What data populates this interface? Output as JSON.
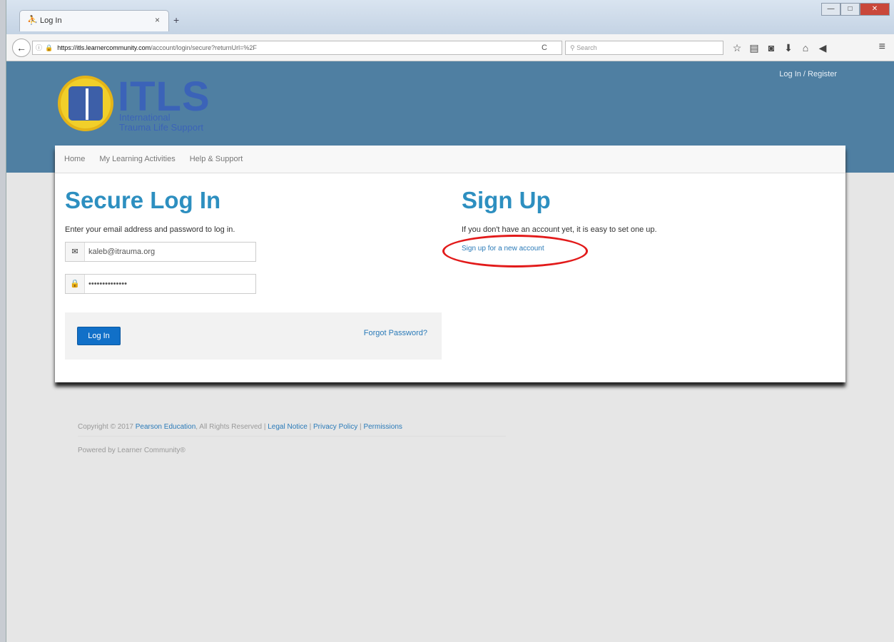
{
  "browser": {
    "tab_title": "Log In",
    "tab_close": "×",
    "new_tab": "+",
    "url_host": "https://itls.learnercommunity.com",
    "url_path": "/account/login/secure?returnUrl=%2F",
    "search_placeholder": "Search",
    "reload": "C",
    "win_min": "—",
    "win_max": "□",
    "win_close": "✕"
  },
  "header": {
    "login_register": "Log In / Register",
    "logo_text": "ITLS",
    "logo_sub_line1": "International",
    "logo_sub_line2": "Trauma Life Support"
  },
  "nav": {
    "items": [
      "Home",
      "My Learning Activities",
      "Help & Support"
    ]
  },
  "login": {
    "heading": "Secure Log In",
    "intro": "Enter your email address and password to log in.",
    "email_value": "kaleb@itrauma.org",
    "password_value": "••••••••••••••",
    "button": "Log In",
    "forgot": "Forgot Password?"
  },
  "signup": {
    "heading": "Sign Up",
    "intro": "If you don't have an account yet, it is easy to set one up.",
    "link": "Sign up for a new account"
  },
  "footer": {
    "copyright_prefix": "Copyright © 2017",
    "company": "Pearson Education",
    "rights": ", All Rights Reserved |",
    "legal": "Legal Notice",
    "sep1": "|",
    "privacy": "Privacy Policy",
    "sep2": "|",
    "permissions": "Permissions",
    "powered": "Powered by Learner Community®"
  },
  "colors": {
    "header_bg": "#4f7fa2",
    "heading_blue": "#2d8fc0",
    "button_blue": "#1170c8",
    "annotation_red": "#e21a1a"
  }
}
